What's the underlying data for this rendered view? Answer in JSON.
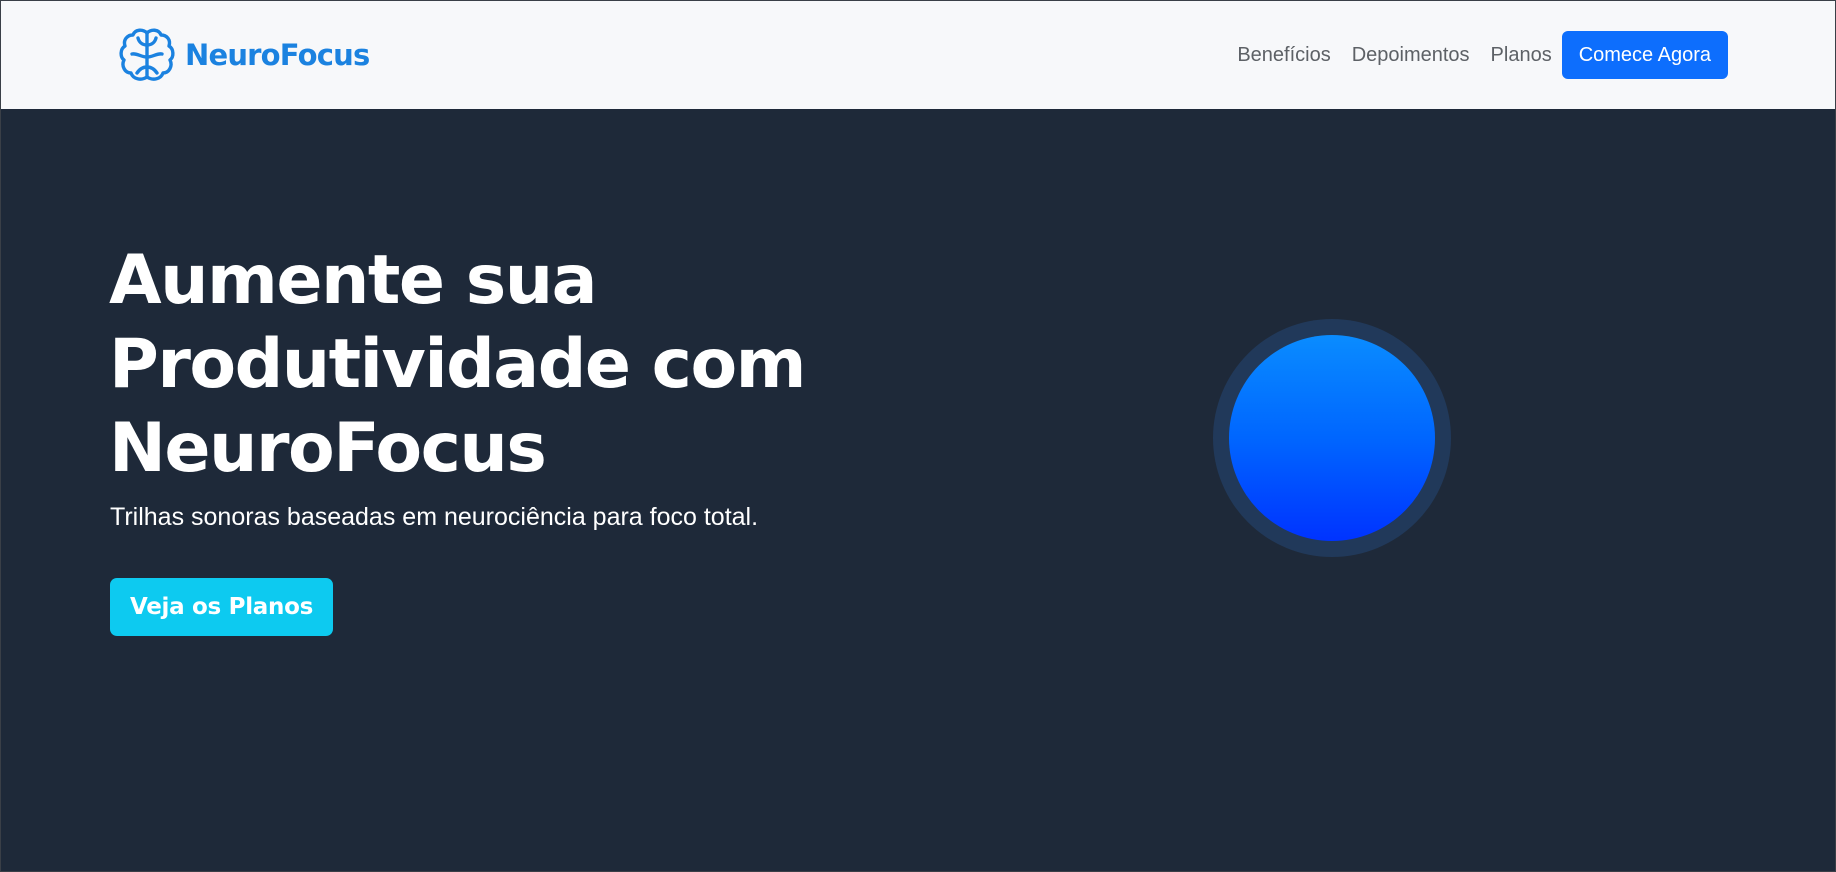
{
  "navbar": {
    "brand": {
      "name": "NeuroFocus",
      "icon": "brain-icon",
      "color": "#1b82e0"
    },
    "links": [
      {
        "label": "Benefícios"
      },
      {
        "label": "Depoimentos"
      },
      {
        "label": "Planos"
      }
    ],
    "cta_label": "Comece Agora",
    "cta_color": "#0d6efd",
    "background": "#f7f8fa"
  },
  "hero": {
    "title_lines": [
      "Aumente sua",
      "Produtividade com",
      "NeuroFocus"
    ],
    "subtitle": "Trilhas sonoras baseadas em neurociência para foco total.",
    "button_label": "Veja os Planos",
    "button_color": "#0dcaf0",
    "background": "#1e2939",
    "orb_colors": [
      "#0a8cff",
      "#0033ff"
    ]
  }
}
